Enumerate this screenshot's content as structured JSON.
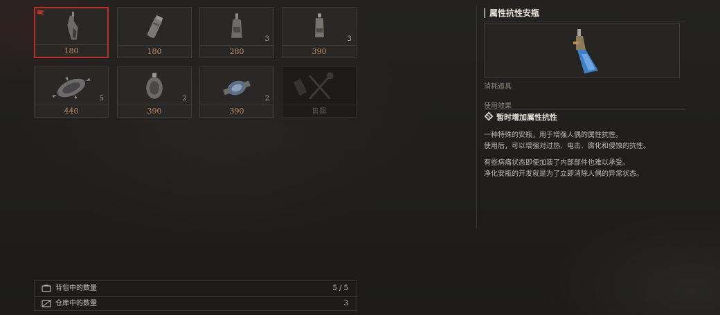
{
  "inventory": {
    "items": [
      {
        "icon": "red-bottle-flask-icon",
        "price": "180",
        "quantity": "",
        "selected": true
      },
      {
        "icon": "canister-icon",
        "price": "180",
        "quantity": "",
        "selected": false
      },
      {
        "icon": "bottle-icon",
        "price": "280",
        "quantity": "3",
        "selected": false
      },
      {
        "icon": "vial-icon",
        "price": "390",
        "quantity": "3",
        "selected": false
      },
      {
        "icon": "spiked-grenade-icon",
        "price": "440",
        "quantity": "5",
        "selected": false
      },
      {
        "icon": "round-flask-icon",
        "price": "390",
        "quantity": "2",
        "selected": false
      },
      {
        "icon": "blue-bomb-icon",
        "price": "390",
        "quantity": "2",
        "selected": false
      },
      {
        "icon": "tools-icon",
        "price": "售罄",
        "quantity": "",
        "selected": false,
        "sold_out": true
      }
    ]
  },
  "counts": {
    "backpack_label": "背包中的数量",
    "backpack_value": "5 / 5",
    "storage_label": "仓库中的数量",
    "storage_value": "3"
  },
  "detail": {
    "title": "属性抗性安瓶",
    "category": "消耗道具",
    "effect_label": "使用效果",
    "effect": "暂时增加属性抗性",
    "desc": [
      [
        "一种特殊的安瓶，用于增强人偶的属性抗性。",
        "使用后，可以增强对过热、电击、腐化和侵蚀的抗性。"
      ],
      [
        "有些病痛状态即使加装了内部部件也难以承受。",
        "净化安瓶的开发就是为了立即消除人偶的异常状态。"
      ]
    ]
  },
  "colors": {
    "selected_border": "#b8322c",
    "price": "#c08a63",
    "ampoule_blue": "#3f7fc4"
  }
}
